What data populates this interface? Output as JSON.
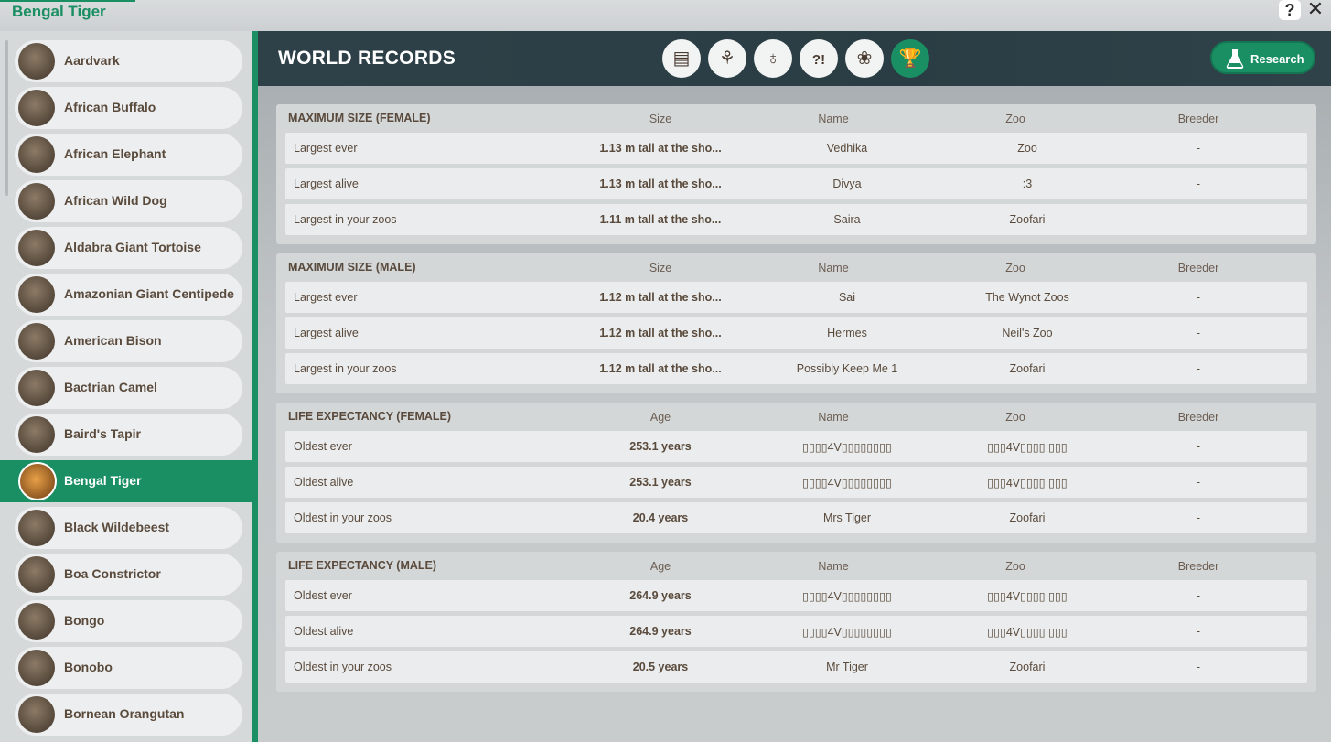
{
  "window": {
    "title": "Bengal Tiger",
    "help": "?",
    "close": "✕"
  },
  "sidebar": {
    "items": [
      {
        "label": "Aardvark"
      },
      {
        "label": "African Buffalo"
      },
      {
        "label": "African Elephant"
      },
      {
        "label": "African Wild Dog"
      },
      {
        "label": "Aldabra Giant Tortoise"
      },
      {
        "label": "Amazonian Giant Centipede"
      },
      {
        "label": "American Bison"
      },
      {
        "label": "Bactrian Camel"
      },
      {
        "label": "Baird's Tapir"
      },
      {
        "label": "Bengal Tiger",
        "selected": true
      },
      {
        "label": "Black Wildebeest"
      },
      {
        "label": "Boa Constrictor"
      },
      {
        "label": "Bongo"
      },
      {
        "label": "Bonobo"
      },
      {
        "label": "Bornean Orangutan"
      }
    ]
  },
  "header": {
    "title": "WORLD RECORDS",
    "tabs": [
      {
        "icon": "clipboard-icon",
        "glyph": "▤"
      },
      {
        "icon": "biome-icon",
        "glyph": "⚘"
      },
      {
        "icon": "enrichment-icon",
        "glyph": "♁"
      },
      {
        "icon": "behaviour-icon",
        "glyph": "?!"
      },
      {
        "icon": "paw-icon",
        "glyph": "❀"
      },
      {
        "icon": "trophy-icon",
        "glyph": "🏆",
        "active": true
      }
    ],
    "research_label": "Research"
  },
  "sections": [
    {
      "title": "MAXIMUM SIZE (FEMALE)",
      "columns": [
        "Size",
        "Name",
        "Zoo",
        "Breeder"
      ],
      "rows": [
        {
          "label": "Largest ever",
          "value": "1.13 m tall at the sho...",
          "name": "Vedhika",
          "zoo": "Zoo",
          "breeder": "-"
        },
        {
          "label": "Largest alive",
          "value": "1.13 m tall at the sho...",
          "name": "Divya",
          "zoo": ":3",
          "breeder": "-"
        },
        {
          "label": "Largest in your zoos",
          "value": "1.11 m tall at the sho...",
          "name": "Saira",
          "zoo": "Zoofari",
          "breeder": "-"
        }
      ]
    },
    {
      "title": "MAXIMUM SIZE (MALE)",
      "columns": [
        "Size",
        "Name",
        "Zoo",
        "Breeder"
      ],
      "rows": [
        {
          "label": "Largest ever",
          "value": "1.12 m tall at the sho...",
          "name": "Sai",
          "zoo": "The Wynot Zoos",
          "breeder": "-"
        },
        {
          "label": "Largest alive",
          "value": "1.12 m tall at the sho...",
          "name": "Hermes",
          "zoo": "Neil's Zoo",
          "breeder": "-"
        },
        {
          "label": "Largest in your zoos",
          "value": "1.12 m tall at the sho...",
          "name": "Possibly Keep Me 1",
          "zoo": "Zoofari",
          "breeder": "-"
        }
      ]
    },
    {
      "title": "LIFE EXPECTANCY (FEMALE)",
      "columns": [
        "Age",
        "Name",
        "Zoo",
        "Breeder"
      ],
      "rows": [
        {
          "label": "Oldest ever",
          "value": "253.1 years",
          "name": "▯▯▯▯4V▯▯▯▯▯▯▯▯",
          "zoo": "▯▯▯4V▯▯▯▯ ▯▯▯",
          "breeder": "-"
        },
        {
          "label": "Oldest alive",
          "value": "253.1 years",
          "name": "▯▯▯▯4V▯▯▯▯▯▯▯▯",
          "zoo": "▯▯▯4V▯▯▯▯ ▯▯▯",
          "breeder": "-"
        },
        {
          "label": "Oldest in your zoos",
          "value": "20.4 years",
          "name": "Mrs Tiger",
          "zoo": "Zoofari",
          "breeder": "-"
        }
      ]
    },
    {
      "title": "LIFE EXPECTANCY (MALE)",
      "columns": [
        "Age",
        "Name",
        "Zoo",
        "Breeder"
      ],
      "rows": [
        {
          "label": "Oldest ever",
          "value": "264.9 years",
          "name": "▯▯▯▯4V▯▯▯▯▯▯▯▯",
          "zoo": "▯▯▯4V▯▯▯▯ ▯▯▯",
          "breeder": "-"
        },
        {
          "label": "Oldest alive",
          "value": "264.9 years",
          "name": "▯▯▯▯4V▯▯▯▯▯▯▯▯",
          "zoo": "▯▯▯4V▯▯▯▯ ▯▯▯",
          "breeder": "-"
        },
        {
          "label": "Oldest in your zoos",
          "value": "20.5 years",
          "name": "Mr Tiger",
          "zoo": "Zoofari",
          "breeder": "-"
        }
      ]
    }
  ],
  "colors": {
    "accent": "#1a8f63",
    "header": "#2e4148",
    "text": "#5a4a3c"
  }
}
